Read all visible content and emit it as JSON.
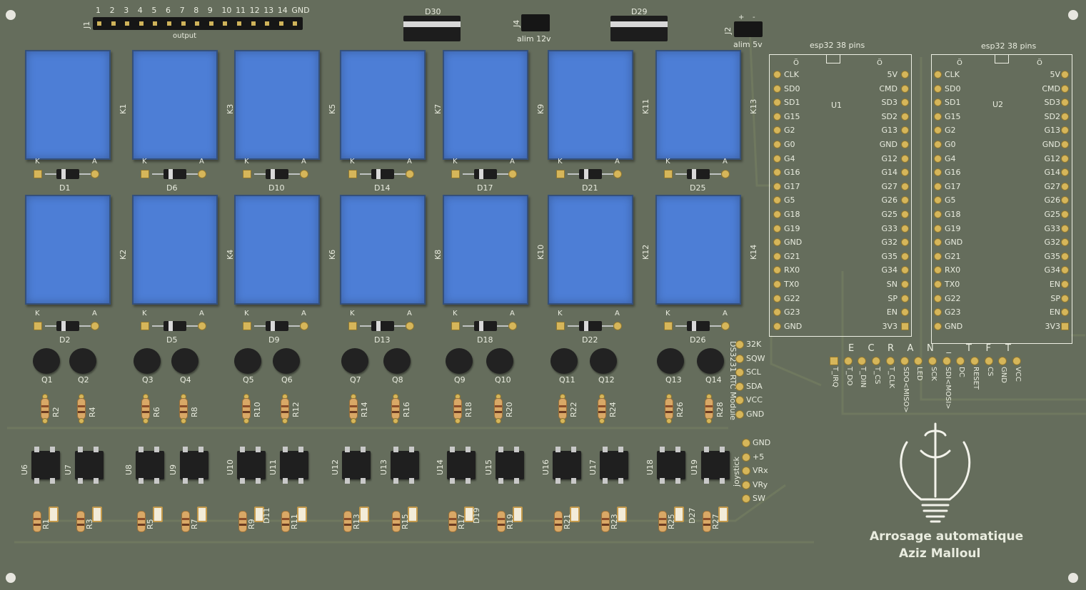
{
  "output_header": {
    "ref": "J1",
    "pins": [
      "1",
      "2",
      "3",
      "4",
      "5",
      "6",
      "7",
      "8",
      "9",
      "10",
      "11",
      "12",
      "13",
      "14",
      "GND"
    ],
    "label": "output"
  },
  "power": {
    "d30": "D30",
    "d29": "D29",
    "j4": {
      "ref": "J4",
      "label": "alim 12v"
    },
    "j2": {
      "ref": "J2",
      "label": "alim 5v",
      "plus": "+",
      "minus": "-"
    }
  },
  "relays_top": [
    "K1",
    "K3",
    "K5",
    "K7",
    "K9",
    "K11",
    "K13"
  ],
  "relays_bottom": [
    "K2",
    "K4",
    "K6",
    "K8",
    "K10",
    "K12",
    "K14"
  ],
  "diodes_top": [
    "D1",
    "D6",
    "D10",
    "D14",
    "D17",
    "D21",
    "D25"
  ],
  "diodes_bottom": [
    "D2",
    "D5",
    "D9",
    "D13",
    "D18",
    "D22",
    "D26"
  ],
  "diode_pins": {
    "k": "K",
    "a": "A"
  },
  "transistors": [
    "Q1",
    "Q2",
    "Q3",
    "Q4",
    "Q5",
    "Q6",
    "Q7",
    "Q8",
    "Q9",
    "Q10",
    "Q11",
    "Q12",
    "Q13",
    "Q14"
  ],
  "resistors_upper": [
    "R2",
    "R4",
    "R6",
    "R8",
    "R10",
    "R12",
    "R14",
    "R16",
    "R18",
    "R20",
    "R22",
    "R24",
    "R26",
    "R28"
  ],
  "optos": [
    "U6",
    "U7",
    "U8",
    "U9",
    "U10",
    "U11",
    "U12",
    "U13",
    "U14",
    "U15",
    "U16",
    "U17",
    "U18",
    "U19"
  ],
  "resistors_lower": [
    "R1",
    "R3",
    "R5",
    "R7",
    "R9",
    "R11",
    "R13",
    "R15",
    "R17",
    "R19",
    "R21",
    "R23",
    "R25",
    "R27"
  ],
  "leds": [
    "D11",
    "D19",
    "D27"
  ],
  "rtc": {
    "title": "DS3231 RTC Module",
    "pins": [
      "32K",
      "SQW",
      "SCL",
      "SDA",
      "VCC",
      "GND"
    ]
  },
  "joystick": {
    "title": "joystick",
    "pins": [
      "GND",
      "+5",
      "VRx",
      "VRy",
      "SW"
    ]
  },
  "esp1": {
    "title": "esp32 38 pins",
    "ref": "U1",
    "ant": "Ö"
  },
  "esp2": {
    "title": "esp32 38 pins",
    "ref": "U2",
    "ant": "Ö"
  },
  "esp_left_pins": [
    "CLK",
    "SD0",
    "SD1",
    "G15",
    "G2",
    "G0",
    "G4",
    "G16",
    "G17",
    "G5",
    "G18",
    "G19",
    "GND",
    "G21",
    "RX0",
    "TX0",
    "G22",
    "G23",
    "GND"
  ],
  "esp_right_pins": [
    "5V",
    "CMD",
    "SD3",
    "SD2",
    "G13",
    "GND",
    "G12",
    "G14",
    "G27",
    "G26",
    "G25",
    "G33",
    "G32",
    "G35",
    "G34",
    "SN",
    "SP",
    "EN",
    "3V3"
  ],
  "esp2_right_pins": [
    "5V",
    "CMD",
    "SD3",
    "SD2",
    "G13",
    "GND",
    "G12",
    "G14",
    "G27",
    "G26",
    "G25",
    "G33",
    "G32",
    "G35",
    "G34",
    "EN",
    "SP",
    "EN",
    "3V3"
  ],
  "screen": {
    "title": [
      "E",
      "C",
      "R",
      "A",
      "N",
      "_",
      "T",
      "F",
      "T"
    ],
    "pins": [
      "T_IRQ",
      "T_DO",
      "T_DIN",
      "T_CS",
      "T_CLK",
      "SDO<MISO>",
      "LED",
      "SCK",
      "SDI<MOSI>",
      "DC",
      "RESET",
      "CS",
      "GND",
      "VCC"
    ]
  },
  "credits": {
    "line1": "Arrosage automatique",
    "line2": "Aziz Malloul"
  },
  "colors": {
    "board": "#656d5c",
    "relay": "#4d7ed6",
    "silk": "#e9ecdf",
    "pad": "#d6b65a"
  }
}
